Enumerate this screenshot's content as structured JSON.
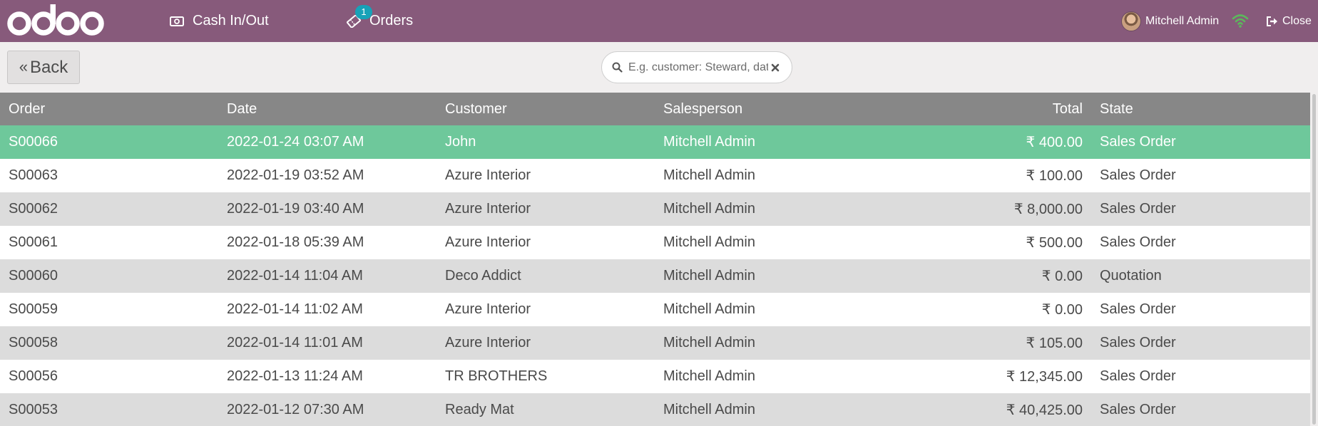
{
  "header": {
    "logo_text": "odoo",
    "nav": {
      "cash_label": "Cash In/Out",
      "orders_label": "Orders",
      "orders_badge": "1"
    },
    "user_name": "Mitchell Admin",
    "close_label": "Close",
    "colors": {
      "bar": "#875a7b",
      "wifi": "#5cb85c"
    }
  },
  "controls": {
    "back_label": "Back",
    "search_placeholder": "E.g. customer: Steward, date: "
  },
  "table": {
    "columns": [
      "Order",
      "Date",
      "Customer",
      "Salesperson",
      "Total",
      "State"
    ],
    "selected_row": 0,
    "rows": [
      [
        "S00066",
        "2022-01-24 03:07 AM",
        "John",
        "Mitchell Admin",
        "₹ 400.00",
        "Sales Order"
      ],
      [
        "S00063",
        "2022-01-19 03:52 AM",
        "Azure Interior",
        "Mitchell Admin",
        "₹ 100.00",
        "Sales Order"
      ],
      [
        "S00062",
        "2022-01-19 03:40 AM",
        "Azure Interior",
        "Mitchell Admin",
        "₹ 8,000.00",
        "Sales Order"
      ],
      [
        "S00061",
        "2022-01-18 05:39 AM",
        "Azure Interior",
        "Mitchell Admin",
        "₹ 500.00",
        "Sales Order"
      ],
      [
        "S00060",
        "2022-01-14 11:04 AM",
        "Deco Addict",
        "Mitchell Admin",
        "₹ 0.00",
        "Quotation"
      ],
      [
        "S00059",
        "2022-01-14 11:02 AM",
        "Azure Interior",
        "Mitchell Admin",
        "₹ 0.00",
        "Sales Order"
      ],
      [
        "S00058",
        "2022-01-14 11:01 AM",
        "Azure Interior",
        "Mitchell Admin",
        "₹ 105.00",
        "Sales Order"
      ],
      [
        "S00056",
        "2022-01-13 11:24 AM",
        "TR BROTHERS",
        "Mitchell Admin",
        "₹ 12,345.00",
        "Sales Order"
      ],
      [
        "S00053",
        "2022-01-12 07:30 AM",
        "Ready Mat",
        "Mitchell Admin",
        "₹ 40,425.00",
        "Sales Order"
      ]
    ]
  }
}
